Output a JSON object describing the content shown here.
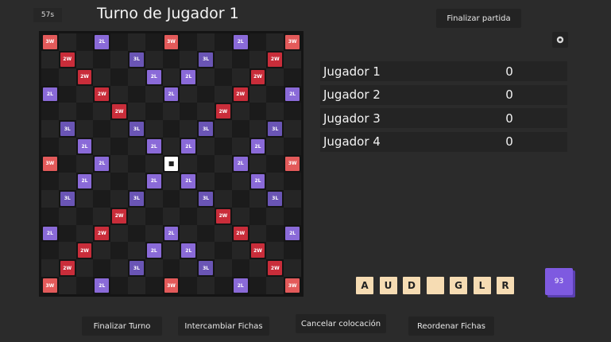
{
  "timer": "57s",
  "turn_title": "Turno de Jugador 1",
  "end_game_label": "Finalizar partida",
  "settings_icon": "gear-icon",
  "board": {
    "size": 15,
    "center_symbol": "■",
    "premium_squares": [
      {
        "r": 0,
        "c": 0,
        "t": "3W"
      },
      {
        "r": 0,
        "c": 7,
        "t": "3W"
      },
      {
        "r": 0,
        "c": 14,
        "t": "3W"
      },
      {
        "r": 7,
        "c": 0,
        "t": "3W"
      },
      {
        "r": 7,
        "c": 14,
        "t": "3W"
      },
      {
        "r": 14,
        "c": 0,
        "t": "3W"
      },
      {
        "r": 14,
        "c": 7,
        "t": "3W"
      },
      {
        "r": 14,
        "c": 14,
        "t": "3W"
      },
      {
        "r": 1,
        "c": 1,
        "t": "2W"
      },
      {
        "r": 2,
        "c": 2,
        "t": "2W"
      },
      {
        "r": 3,
        "c": 3,
        "t": "2W"
      },
      {
        "r": 4,
        "c": 4,
        "t": "2W"
      },
      {
        "r": 1,
        "c": 13,
        "t": "2W"
      },
      {
        "r": 2,
        "c": 12,
        "t": "2W"
      },
      {
        "r": 3,
        "c": 11,
        "t": "2W"
      },
      {
        "r": 4,
        "c": 10,
        "t": "2W"
      },
      {
        "r": 10,
        "c": 4,
        "t": "2W"
      },
      {
        "r": 11,
        "c": 3,
        "t": "2W"
      },
      {
        "r": 12,
        "c": 2,
        "t": "2W"
      },
      {
        "r": 13,
        "c": 1,
        "t": "2W"
      },
      {
        "r": 10,
        "c": 10,
        "t": "2W"
      },
      {
        "r": 11,
        "c": 11,
        "t": "2W"
      },
      {
        "r": 12,
        "c": 12,
        "t": "2W"
      },
      {
        "r": 13,
        "c": 13,
        "t": "2W"
      },
      {
        "r": 1,
        "c": 5,
        "t": "3L"
      },
      {
        "r": 1,
        "c": 9,
        "t": "3L"
      },
      {
        "r": 5,
        "c": 1,
        "t": "3L"
      },
      {
        "r": 5,
        "c": 5,
        "t": "3L"
      },
      {
        "r": 5,
        "c": 9,
        "t": "3L"
      },
      {
        "r": 5,
        "c": 13,
        "t": "3L"
      },
      {
        "r": 9,
        "c": 1,
        "t": "3L"
      },
      {
        "r": 9,
        "c": 5,
        "t": "3L"
      },
      {
        "r": 9,
        "c": 9,
        "t": "3L"
      },
      {
        "r": 9,
        "c": 13,
        "t": "3L"
      },
      {
        "r": 13,
        "c": 5,
        "t": "3L"
      },
      {
        "r": 13,
        "c": 9,
        "t": "3L"
      },
      {
        "r": 0,
        "c": 3,
        "t": "2L"
      },
      {
        "r": 0,
        "c": 11,
        "t": "2L"
      },
      {
        "r": 3,
        "c": 0,
        "t": "2L"
      },
      {
        "r": 3,
        "c": 7,
        "t": "2L"
      },
      {
        "r": 3,
        "c": 14,
        "t": "2L"
      },
      {
        "r": 2,
        "c": 6,
        "t": "2L"
      },
      {
        "r": 2,
        "c": 8,
        "t": "2L"
      },
      {
        "r": 6,
        "c": 2,
        "t": "2L"
      },
      {
        "r": 6,
        "c": 6,
        "t": "2L"
      },
      {
        "r": 6,
        "c": 8,
        "t": "2L"
      },
      {
        "r": 6,
        "c": 12,
        "t": "2L"
      },
      {
        "r": 7,
        "c": 3,
        "t": "2L"
      },
      {
        "r": 7,
        "c": 11,
        "t": "2L"
      },
      {
        "r": 8,
        "c": 2,
        "t": "2L"
      },
      {
        "r": 8,
        "c": 6,
        "t": "2L"
      },
      {
        "r": 8,
        "c": 8,
        "t": "2L"
      },
      {
        "r": 8,
        "c": 12,
        "t": "2L"
      },
      {
        "r": 11,
        "c": 0,
        "t": "2L"
      },
      {
        "r": 11,
        "c": 7,
        "t": "2L"
      },
      {
        "r": 11,
        "c": 14,
        "t": "2L"
      },
      {
        "r": 12,
        "c": 6,
        "t": "2L"
      },
      {
        "r": 12,
        "c": 8,
        "t": "2L"
      },
      {
        "r": 14,
        "c": 3,
        "t": "2L"
      },
      {
        "r": 14,
        "c": 11,
        "t": "2L"
      }
    ]
  },
  "colors": {
    "triple_word": "#e35a5a",
    "double_word": "#c92d3a",
    "triple_letter": "#6a55b5",
    "double_letter": "#8a6ad8",
    "tile": "#f6dcb3",
    "bag": "#7e5ae0"
  },
  "players": [
    {
      "name": "Jugador 1",
      "score": "0"
    },
    {
      "name": "Jugador 2",
      "score": "0"
    },
    {
      "name": "Jugador 3",
      "score": "0"
    },
    {
      "name": "Jugador 4",
      "score": "0"
    }
  ],
  "rack": [
    "A",
    "U",
    "D",
    "",
    "G",
    "L",
    "R"
  ],
  "bag_count": "93",
  "actions": {
    "end_turn": "Finalizar Turno",
    "exchange": "Intercambiar Fichas",
    "cancel": "Cancelar colocación",
    "reorder": "Reordenar Fichas"
  }
}
